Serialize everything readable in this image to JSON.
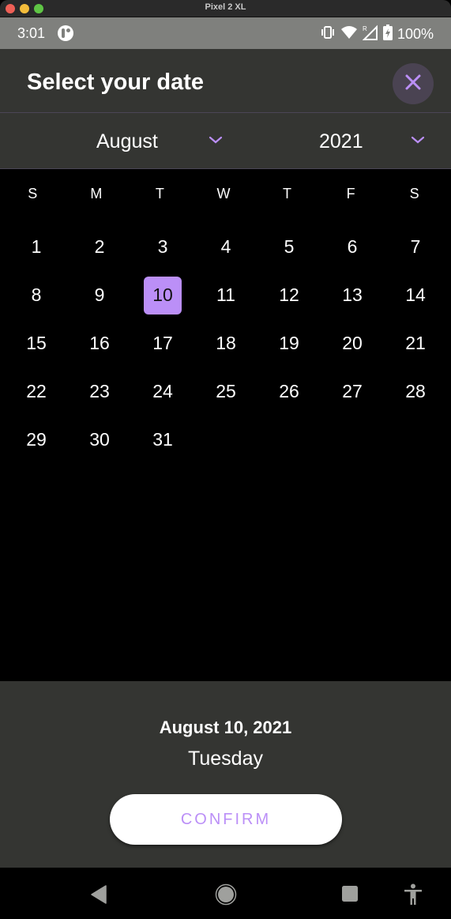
{
  "window": {
    "title": "Pixel 2 XL"
  },
  "status_bar": {
    "time": "3:01",
    "battery": "100%",
    "icons": [
      "app-notification-icon",
      "vibrate-icon",
      "wifi-icon",
      "roaming-signal-icon",
      "battery-charging-icon"
    ],
    "roaming_indicator": "R"
  },
  "header": {
    "title": "Select your date",
    "close_icon": "close-icon"
  },
  "pickers": {
    "month": "August",
    "year": "2021"
  },
  "calendar": {
    "weekdays": [
      "S",
      "M",
      "T",
      "W",
      "T",
      "F",
      "S"
    ],
    "first_weekday_index": 0,
    "days": [
      "1",
      "2",
      "3",
      "4",
      "5",
      "6",
      "7",
      "8",
      "9",
      "10",
      "11",
      "12",
      "13",
      "14",
      "15",
      "16",
      "17",
      "18",
      "19",
      "20",
      "21",
      "22",
      "23",
      "24",
      "25",
      "26",
      "27",
      "28",
      "29",
      "30",
      "31"
    ],
    "selected_day": "10"
  },
  "footer": {
    "selected_date": "August 10, 2021",
    "selected_weekday": "Tuesday",
    "confirm_label": "CONFIRM"
  },
  "colors": {
    "accent": "#bb8ff7",
    "surface": "#343532",
    "background": "#000000",
    "close_button_bg": "#4a4352"
  },
  "navigation_bar": {
    "buttons": [
      "back-icon",
      "home-icon",
      "recents-icon",
      "accessibility-icon"
    ]
  }
}
